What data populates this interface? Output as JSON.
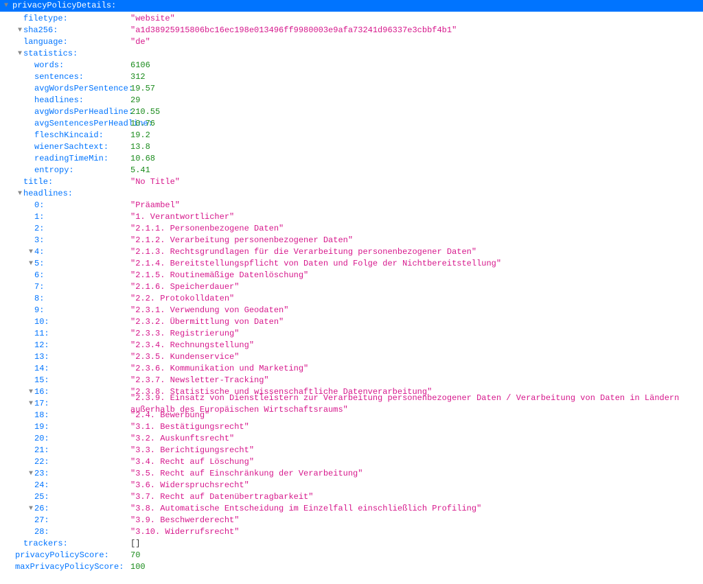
{
  "root": {
    "label": "privacyPolicyDetails:"
  },
  "rows": [
    {
      "indent": 2,
      "tri": "",
      "key": "filetype:",
      "valType": "string",
      "val": "\"website\""
    },
    {
      "indent": 2,
      "tri": "▼",
      "key": "sha256:",
      "valType": "string",
      "val": "\"a1d38925915806bc16ec198e013496ff9980003e9afa73241d96337e3cbbf4b1\""
    },
    {
      "indent": 2,
      "tri": "",
      "key": "language:",
      "valType": "string",
      "val": "\"de\""
    },
    {
      "indent": 2,
      "tri": "▼",
      "key": "statistics:",
      "valType": "",
      "val": ""
    },
    {
      "indent": 3,
      "tri": "",
      "key": "words:",
      "valType": "number",
      "val": "6106"
    },
    {
      "indent": 3,
      "tri": "",
      "key": "sentences:",
      "valType": "number",
      "val": "312"
    },
    {
      "indent": 3,
      "tri": "",
      "key": "avgWordsPerSentence:",
      "valType": "number",
      "val": "19.57"
    },
    {
      "indent": 3,
      "tri": "",
      "key": "headlines:",
      "valType": "number",
      "val": "29"
    },
    {
      "indent": 3,
      "tri": "",
      "key": "avgWordsPerHeadline:",
      "valType": "number",
      "val": "210.55"
    },
    {
      "indent": 3,
      "tri": "",
      "key": "avgSentencesPerHeadline:",
      "valType": "number",
      "val": "10.76"
    },
    {
      "indent": 3,
      "tri": "",
      "key": "fleschKincaid:",
      "valType": "number",
      "val": "19.2"
    },
    {
      "indent": 3,
      "tri": "",
      "key": "wienerSachtext:",
      "valType": "number",
      "val": "13.8"
    },
    {
      "indent": 3,
      "tri": "",
      "key": "readingTimeMin:",
      "valType": "number",
      "val": "10.68"
    },
    {
      "indent": 3,
      "tri": "",
      "key": "entropy:",
      "valType": "number",
      "val": "5.41"
    },
    {
      "indent": 2,
      "tri": "",
      "key": "title:",
      "valType": "string",
      "val": "\"No Title\""
    },
    {
      "indent": 2,
      "tri": "▼",
      "key": "headlines:",
      "valType": "",
      "val": ""
    },
    {
      "indent": 3,
      "tri": "",
      "key": "0:",
      "valType": "string",
      "val": "\"Präambel\""
    },
    {
      "indent": 3,
      "tri": "",
      "key": "1:",
      "valType": "string",
      "val": "\"1.  Verantwortlicher\""
    },
    {
      "indent": 3,
      "tri": "",
      "key": "2:",
      "valType": "string",
      "val": "\"2.1.1.    Personenbezogene Daten\""
    },
    {
      "indent": 3,
      "tri": "",
      "key": "3:",
      "valType": "string",
      "val": "\"2.1.2.    Verarbeitung personenbezogener Daten\""
    },
    {
      "indent": 3,
      "tri": "▼",
      "key": "4:",
      "valType": "string",
      "val": "\"2.1.3.    Rechtsgrundlagen für die Verarbeitung personenbezogener Daten\""
    },
    {
      "indent": 3,
      "tri": "▼",
      "key": "5:",
      "valType": "string",
      "val": "\"2.1.4.    Bereitstellungspflicht von Daten und Folge der Nichtbereitstellung\""
    },
    {
      "indent": 3,
      "tri": "",
      "key": "6:",
      "valType": "string",
      "val": "\"2.1.5.    Routinemäßige Datenlöschung\""
    },
    {
      "indent": 3,
      "tri": "",
      "key": "7:",
      "valType": "string",
      "val": "\"2.1.6.    Speicherdauer\""
    },
    {
      "indent": 3,
      "tri": "",
      "key": "8:",
      "valType": "string",
      "val": "\"2.2.     Protokolldaten\""
    },
    {
      "indent": 3,
      "tri": "",
      "key": "9:",
      "valType": "string",
      "val": "\"2.3.1.    Verwendung von Geodaten\""
    },
    {
      "indent": 3,
      "tri": "",
      "key": "10:",
      "valType": "string",
      "val": "\"2.3.2.    Übermittlung von Daten\""
    },
    {
      "indent": 3,
      "tri": "",
      "key": "11:",
      "valType": "string",
      "val": "\"2.3.3.    Registrierung\""
    },
    {
      "indent": 3,
      "tri": "",
      "key": "12:",
      "valType": "string",
      "val": "\"2.3.4.    Rechnungstellung\""
    },
    {
      "indent": 3,
      "tri": "",
      "key": "13:",
      "valType": "string",
      "val": "\"2.3.5.    Kundenservice\""
    },
    {
      "indent": 3,
      "tri": "",
      "key": "14:",
      "valType": "string",
      "val": "\"2.3.6.    Kommunikation und Marketing\""
    },
    {
      "indent": 3,
      "tri": "",
      "key": "15:",
      "valType": "string",
      "val": "\"2.3.7.    Newsletter-Tracking\""
    },
    {
      "indent": 3,
      "tri": "▼",
      "key": "16:",
      "valType": "string",
      "val": "\"2.3.8.     Statistische und wissenschaftliche Datenverarbeitung\""
    },
    {
      "indent": 3,
      "tri": "▼",
      "key": "17:",
      "valType": "string",
      "val": "\"2.3.9.    Einsatz von Dienstleistern zur Verarbeitung personenbezogener Daten / Verarbeitung von Daten in Ländern außerhalb des Europäischen Wirtschaftsraums\""
    },
    {
      "indent": 3,
      "tri": "",
      "key": "18:",
      "valType": "string",
      "val": "\"2.4.      Bewerbung\""
    },
    {
      "indent": 3,
      "tri": "",
      "key": "19:",
      "valType": "string",
      "val": "\"3.1.     Bestätigungsrecht\""
    },
    {
      "indent": 3,
      "tri": "",
      "key": "20:",
      "valType": "string",
      "val": "\"3.2.     Auskunftsrecht\""
    },
    {
      "indent": 3,
      "tri": "",
      "key": "21:",
      "valType": "string",
      "val": "\"3.3.     Berichtigungsrecht\""
    },
    {
      "indent": 3,
      "tri": "",
      "key": "22:",
      "valType": "string",
      "val": "\"3.4.     Recht auf Löschung\""
    },
    {
      "indent": 3,
      "tri": "▼",
      "key": "23:",
      "valType": "string",
      "val": "\"3.5.     Recht auf Einschränkung der Verarbeitung\""
    },
    {
      "indent": 3,
      "tri": "",
      "key": "24:",
      "valType": "string",
      "val": "\"3.6.     Widerspruchsrecht\""
    },
    {
      "indent": 3,
      "tri": "",
      "key": "25:",
      "valType": "string",
      "val": "\"3.7.     Recht auf Datenübertragbarkeit\""
    },
    {
      "indent": 3,
      "tri": "▼",
      "key": "26:",
      "valType": "string",
      "val": "\"3.8.     Automatische Entscheidung im Einzelfall einschließlich Profiling\""
    },
    {
      "indent": 3,
      "tri": "",
      "key": "27:",
      "valType": "string",
      "val": "\"3.9.     Beschwerderecht\""
    },
    {
      "indent": 3,
      "tri": "",
      "key": "28:",
      "valType": "string",
      "val": "\"3.10.    Widerrufsrecht\""
    },
    {
      "indent": 2,
      "tri": "",
      "key": "trackers:",
      "valType": "other",
      "val": "[]"
    },
    {
      "indent": 1,
      "tri": "",
      "key": "privacyPolicyScore:",
      "valType": "number",
      "val": "70"
    },
    {
      "indent": 1,
      "tri": "",
      "key": "maxPrivacyPolicyScore:",
      "valType": "number",
      "val": "100"
    }
  ]
}
